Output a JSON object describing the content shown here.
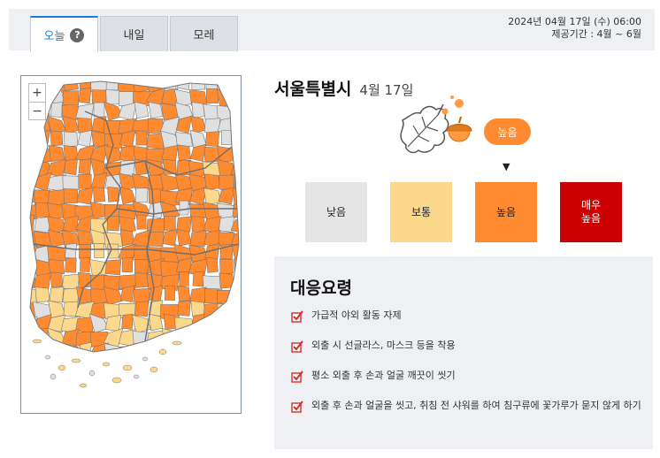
{
  "tabs": [
    {
      "label": "오늘",
      "active": true,
      "help": "?"
    },
    {
      "label": "내일",
      "active": false
    },
    {
      "label": "모레",
      "active": false
    }
  ],
  "meta": {
    "timestamp": "2024년 04월 17일 (수) 06:00",
    "period": "제공기간 : 4월 ~ 6월"
  },
  "map": {
    "zoom_in": "+",
    "zoom_out": "−",
    "region_colors": [
      "#ff8a30",
      "#fbd88c",
      "#e0e0e0",
      "#ffc878"
    ],
    "border_color": "#777777"
  },
  "city": {
    "name": "서울특별시",
    "date": "4월 17일"
  },
  "current": {
    "label": "높음",
    "pointer": "▼",
    "color": "#ff8a30",
    "level_index": 2
  },
  "levels": [
    {
      "label": "낮음",
      "color": "#e5e5e5"
    },
    {
      "label": "보통",
      "color": "#fbd88c"
    },
    {
      "label": "높음",
      "color": "#ff8a30"
    },
    {
      "label_line1": "매우",
      "label_line2": "높음",
      "color": "#cc0000"
    }
  ],
  "guide": {
    "title": "대응요령",
    "items": [
      "가급적 야외 활동 자제",
      "외출 시 선글라스, 마스크 등을 착용",
      "평소 외출 후 손과 얼굴 깨끗이 씻기",
      "외출 후 손과 얼굴을 씻고, 취침 전 샤워를 하여 침구류에 꽃가루가 묻지 않게 하기"
    ],
    "check_color": "#d42a2a"
  }
}
